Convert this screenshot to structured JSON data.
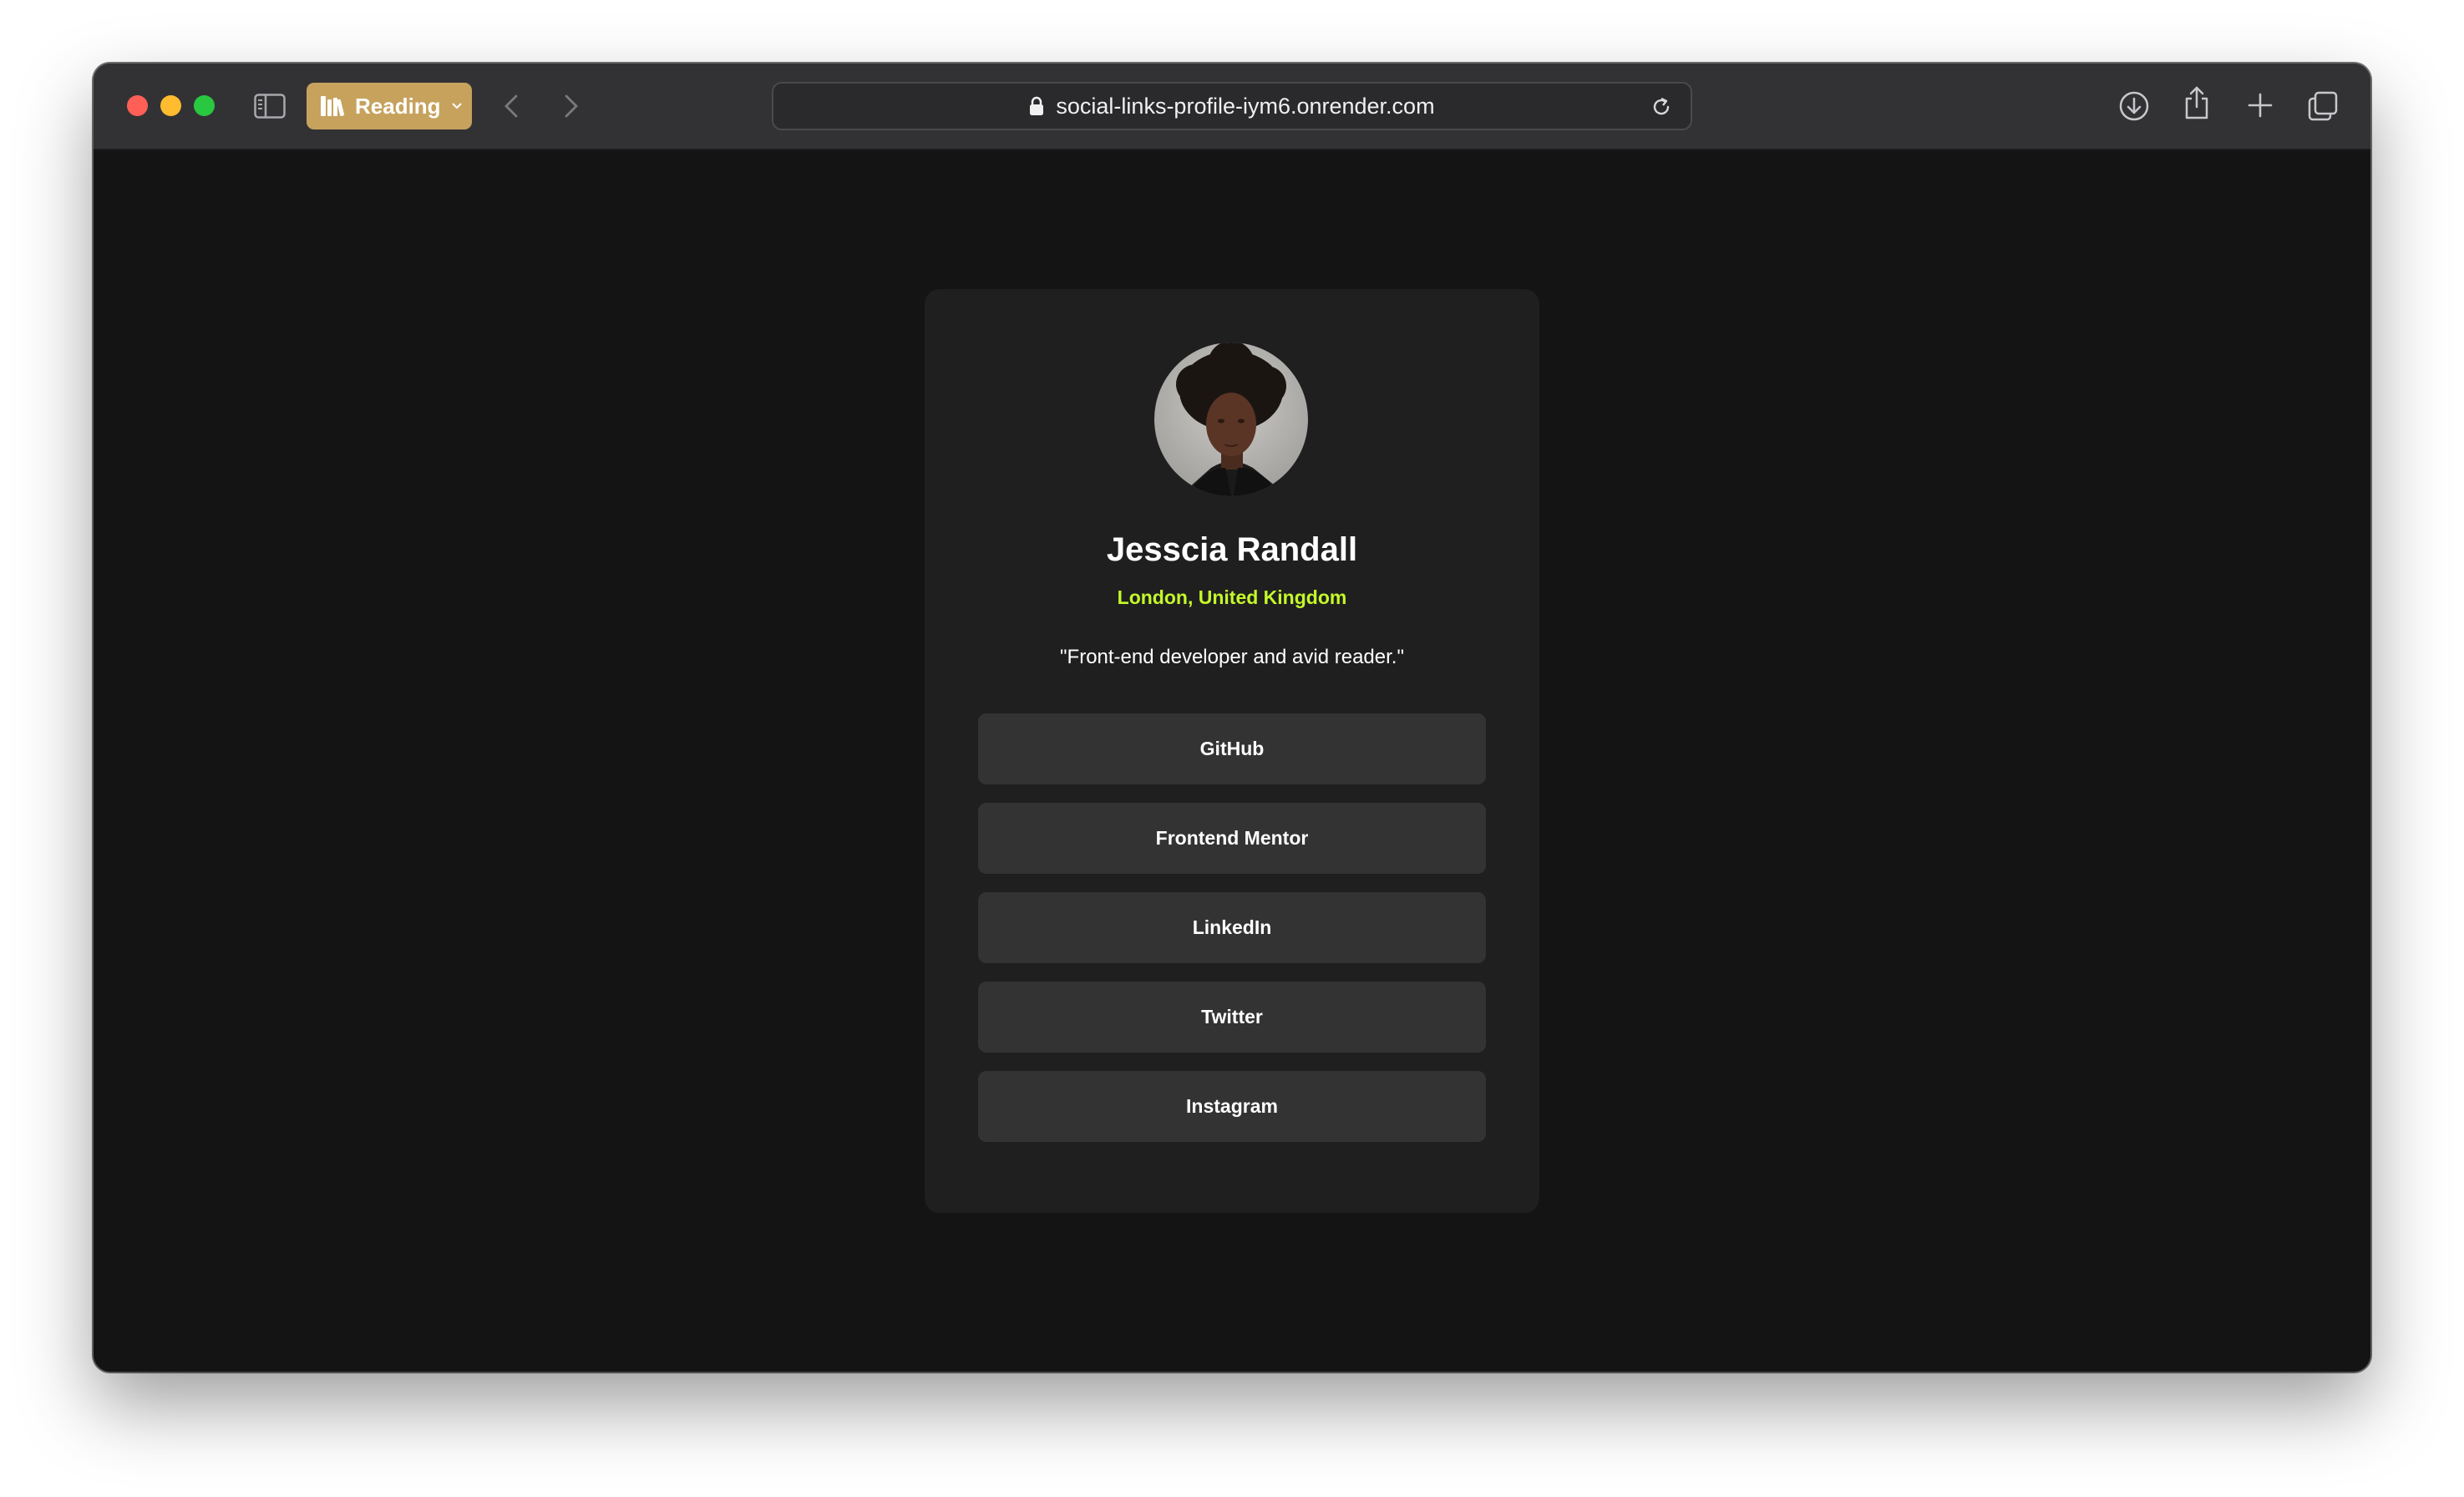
{
  "browser": {
    "tab_group_label": "Reading",
    "url": "social-links-profile-iym6.onrender.com",
    "icons": {
      "sidebar": "sidebar-icon",
      "tab_group": "books-icon",
      "back": "chevron-left-icon",
      "forward": "chevron-right-icon",
      "lock": "lock-icon",
      "reload": "reload-icon",
      "download": "download-icon",
      "share": "share-icon",
      "new_tab": "plus-icon",
      "tab_overview": "tabs-icon"
    },
    "colors": {
      "tab_group": "#c6a25d",
      "toolbar": "#323235",
      "close": "#fe5f57",
      "minimize": "#febc2e",
      "zoom": "#28c840"
    }
  },
  "profile": {
    "name": "Jesscia Randall",
    "location": "London, United Kingdom",
    "bio": "\"Front-end developer and avid reader.\"",
    "links": [
      {
        "label": "GitHub"
      },
      {
        "label": "Frontend Mentor"
      },
      {
        "label": "LinkedIn"
      },
      {
        "label": "Twitter"
      },
      {
        "label": "Instagram"
      }
    ],
    "colors": {
      "background": "#141414",
      "card": "#1f1f1f",
      "button": "#333333",
      "accent": "#c4f82a",
      "text": "#ffffff"
    }
  }
}
